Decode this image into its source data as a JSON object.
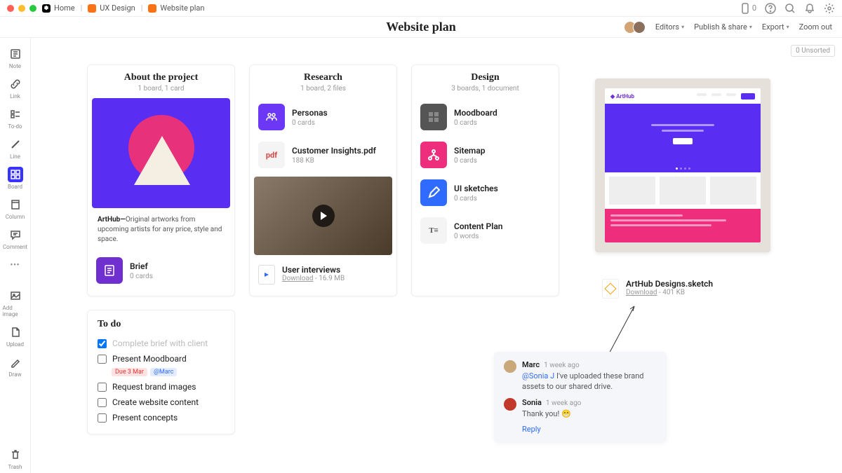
{
  "chrome": {
    "home": "Home",
    "crumb1": "UX Design",
    "crumb2": "Website plan",
    "notif_count": "0"
  },
  "titlebar": {
    "title": "Website plan",
    "editors": "Editors",
    "publish": "Publish & share",
    "export": "Export",
    "zoom": "Zoom out"
  },
  "sidebar": {
    "note": "Note",
    "link": "Link",
    "todo": "To-do",
    "line": "Line",
    "board": "Board",
    "column": "Column",
    "comment": "Comment",
    "addimage": "Add image",
    "upload": "Upload",
    "draw": "Draw",
    "trash": "Trash"
  },
  "unsorted": "0 Unsorted",
  "about": {
    "title": "About the project",
    "sub": "1 board, 1 card",
    "desc_bold": "ArtHub—",
    "desc_rest": "Original artworks from upcoming artists for any price, style and space.",
    "brief": "Brief",
    "brief_meta": "0 cards"
  },
  "research": {
    "title": "Research",
    "sub": "1 board, 2 files",
    "personas": "Personas",
    "personas_meta": "0 cards",
    "pdf": "Customer Insights.pdf",
    "pdf_meta": "188 KB",
    "interviews": "User interviews",
    "dl": "Download",
    "dl_meta": " - 16.9 MB"
  },
  "design": {
    "title": "Design",
    "sub": "3 boards, 1 document",
    "mood": "Moodboard",
    "mood_meta": "0 cards",
    "sitemap": "Sitemap",
    "sitemap_meta": "0 cards",
    "ui": "UI sketches",
    "ui_meta": "0 cards",
    "content": "Content Plan",
    "content_meta": "0 words"
  },
  "sketch": {
    "name": "ArtHub Designs.sketch",
    "dl": "Download",
    "dl_meta": " - 401 KB",
    "logo": "ArtHub"
  },
  "todo": {
    "title": "To do",
    "items": [
      "Complete brief with client",
      "Present Moodboard",
      "Request brand images",
      "Create website content",
      "Present concepts"
    ],
    "due": "Due 3 Mar",
    "mention": "@Marc"
  },
  "comments": {
    "c1_name": "Marc",
    "c1_time": "1 week ago",
    "c1_mention": "@Sonia J",
    "c1_text": " I've uploaded these brand assets to our shared drive.",
    "c2_name": "Sonia",
    "c2_time": "1 week ago",
    "c2_text": "Thank you! 😁",
    "reply": "Reply"
  }
}
